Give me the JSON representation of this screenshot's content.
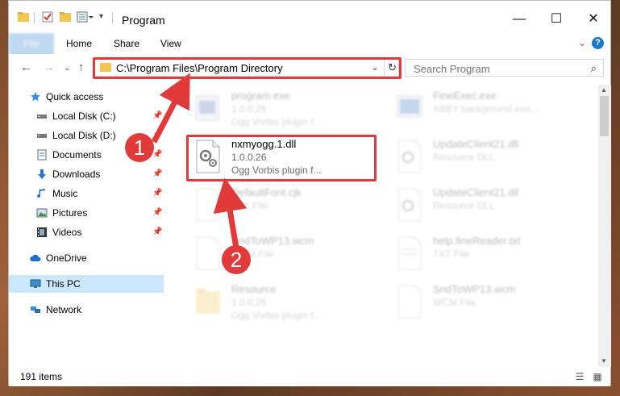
{
  "window": {
    "title": "Program"
  },
  "ribbon": {
    "tabs": [
      "File",
      "Home",
      "Share",
      "View"
    ],
    "help": "?"
  },
  "address": {
    "path": "C:\\Program Files\\Program Directory"
  },
  "search": {
    "placeholder": "Search Program"
  },
  "sidebar": {
    "items": [
      {
        "label": "Quick access",
        "icon": "star-icon"
      },
      {
        "label": "Local Disk (C:)",
        "icon": "drive-icon"
      },
      {
        "label": "Local Disk (D:)",
        "icon": "drive-icon"
      },
      {
        "label": "Documents",
        "icon": "documents-icon"
      },
      {
        "label": "Downloads",
        "icon": "download-icon"
      },
      {
        "label": "Music",
        "icon": "music-icon"
      },
      {
        "label": "Pictures",
        "icon": "pictures-icon"
      },
      {
        "label": "Videos",
        "icon": "videos-icon"
      },
      {
        "label": "OneDrive",
        "icon": "cloud-icon"
      },
      {
        "label": "This PC",
        "icon": "computer-icon"
      },
      {
        "label": "Network",
        "icon": "network-icon"
      }
    ]
  },
  "files": [
    {
      "name": "program.exe",
      "line2": "1.0.0.26",
      "line3": "Ogg Vorbis plugin f..."
    },
    {
      "name": "FineExec.exe",
      "line2": "ABBY background exe...",
      "line3": ""
    },
    {
      "name": "nxmyogg.1.dll",
      "line2": "1.0.0.26",
      "line3": "Ogg Vorbis plugin f..."
    },
    {
      "name": "UpdateClient21.dll",
      "line2": "Resource DLL",
      "line3": ""
    },
    {
      "name": "DefaultFont.cjk",
      "line2": "CJK File",
      "line3": ""
    },
    {
      "name": "UpdateClient21.dll",
      "line2": "Resource DLL",
      "line3": ""
    },
    {
      "name": "SndToWP13.wcm",
      "line2": "WCM File",
      "line3": ""
    },
    {
      "name": "help.fineReader.txt",
      "line2": "TXT File",
      "line3": ""
    },
    {
      "name": "Resource",
      "line2": "1.0.0.26",
      "line3": "Ogg Vorbis plugin f..."
    },
    {
      "name": "SndToWP13.wcm",
      "line2": "WCM File",
      "line3": ""
    }
  ],
  "status": {
    "count": "191 items"
  },
  "annotations": {
    "step1": "1",
    "step2": "2",
    "color": "#e03a3a"
  }
}
